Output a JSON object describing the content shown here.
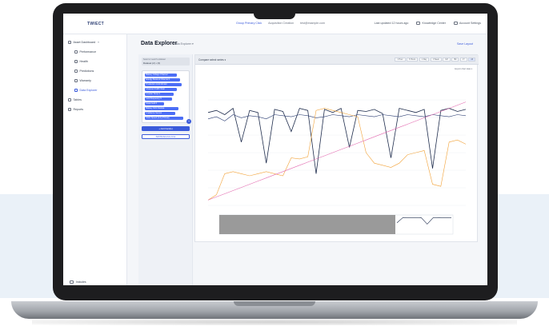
{
  "app": {
    "logo": "TWIECT"
  },
  "topbar": {
    "links": [
      "Group Primary Click",
      "Acquisition Creation",
      "test@example.com"
    ],
    "right_items": [
      "Last updated 12 hours ago",
      "Knowledge Center",
      "Account Settings"
    ]
  },
  "sidebar": {
    "items": [
      {
        "label": "Asset Dashboard",
        "active": false,
        "level": 0
      },
      {
        "label": "Performance",
        "active": false,
        "level": 1
      },
      {
        "label": "Health",
        "active": false,
        "level": 1
      },
      {
        "label": "Predictions",
        "active": false,
        "level": 1
      },
      {
        "label": "Warranty",
        "active": false,
        "level": 1
      },
      {
        "label": "Data Explorer",
        "active": true,
        "level": 1
      },
      {
        "label": "Tables",
        "active": false,
        "level": 0
      },
      {
        "label": "Reports",
        "active": false,
        "level": 0
      }
    ],
    "footer_label": "Includes"
  },
  "page": {
    "title": "Data Explorer",
    "subtitle": "Data Explorer",
    "top_link": "Save Layout"
  },
  "filters": {
    "dataset_label": "Select or search a dataset",
    "dataset_value": "Dataset (2) • (3)",
    "tags": [
      "Battery Voltage Channel",
      "Energy Metered Channel 1",
      "Production Grid Monitor",
      "Channel 3 kWh Total",
      "Inverter Temp 4",
      "Grid Frequency 5",
      "Data Field 6",
      "Battery SOC Module",
      "Irradiance Sensor",
      "Wind Speed (m/s) Primary"
    ],
    "primary_button": "+ Add Field(s)",
    "secondary_button": "Add Reference Line"
  },
  "chart": {
    "selector_label": "Compare select series ▾",
    "range_buttons": [
      "1 Hour",
      "6 Hours",
      "1 Day",
      "1 Week",
      "1M",
      "3M",
      "1Y",
      "All"
    ],
    "active_range": "All",
    "export_label": "Export chart data ▾",
    "colors": {
      "primary_series": "#1f2d4d",
      "secondary_series": "#2c3e73",
      "orange_series": "#f2a33a",
      "pink_series": "#e36bb0",
      "grid": "#eef0f4",
      "navigator_fill": "#9a9a9a"
    }
  },
  "chart_data": {
    "type": "line",
    "title": "",
    "xlabel": "",
    "ylabel": "",
    "legend_placement": "top",
    "grid": true,
    "series": [
      {
        "values": [
          88,
          90,
          86,
          92,
          60,
          90,
          88,
          40,
          91,
          89,
          70,
          92,
          90,
          30,
          91,
          88,
          92,
          55,
          90,
          89,
          91,
          87,
          45,
          92,
          90,
          88,
          91,
          35,
          90,
          92,
          89,
          91
        ]
      },
      {
        "values": [
          82,
          84,
          80,
          86,
          83,
          85,
          84,
          82,
          86,
          85,
          84,
          86,
          85,
          83,
          84,
          86,
          85,
          84,
          86,
          85,
          84,
          86,
          85,
          84,
          86,
          85,
          84,
          86,
          85,
          84,
          86,
          85
        ]
      },
      {
        "values": [
          5,
          10,
          30,
          32,
          30,
          28,
          30,
          32,
          30,
          28,
          45,
          44,
          46,
          90,
          92,
          90,
          88,
          86,
          84,
          50,
          40,
          38,
          36,
          40,
          48,
          50,
          52,
          20,
          18,
          60,
          62,
          58
        ]
      },
      {
        "values": [
          5,
          8,
          11,
          14,
          17,
          20,
          23,
          26,
          29,
          32,
          35,
          38,
          41,
          44,
          47,
          50,
          53,
          56,
          59,
          62,
          65,
          68,
          71,
          74,
          77,
          80,
          83,
          86,
          89,
          92,
          95,
          98
        ]
      }
    ],
    "ylim": [
      0,
      100
    ]
  }
}
